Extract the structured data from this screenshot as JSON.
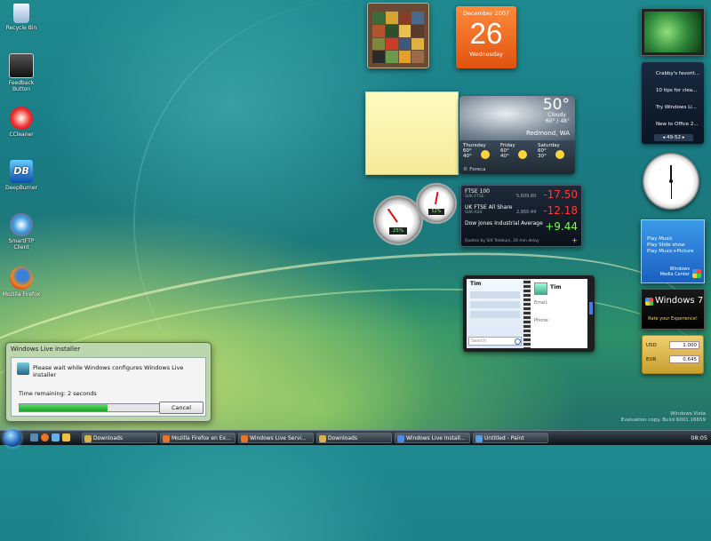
{
  "desktop_icons": [
    {
      "label": "Recycle Bin",
      "icon": "recycle-bin-icon"
    },
    {
      "label": "Feedback Button",
      "icon": "feedback-icon"
    },
    {
      "label": "CCleaner",
      "icon": "ccleaner-icon"
    },
    {
      "label": "DeepBurner",
      "icon": "deepburner-icon"
    },
    {
      "label": "SmartFTP Client",
      "icon": "ftp-icon"
    },
    {
      "label": "Mozilla Firefox",
      "icon": "firefox-icon"
    }
  ],
  "calendar": {
    "month_year": "December 2007",
    "day": "26",
    "weekday": "Wednesday"
  },
  "weather": {
    "temp": "50°",
    "condition": "Cloudy",
    "current_range": "60° / 48°",
    "location": "Redmond, WA",
    "forecast": [
      {
        "day": "Thursday",
        "hi": "60°",
        "lo": "40°"
      },
      {
        "day": "Friday",
        "hi": "60°",
        "lo": "40°"
      },
      {
        "day": "Saturday",
        "hi": "60°",
        "lo": "30°"
      }
    ],
    "source": "© Foreca"
  },
  "feeds": {
    "items": [
      "Crabby's favorit...",
      "10 tips for clea...",
      "Try Windows Li...",
      "New to Office 2..."
    ],
    "pager": "49-52"
  },
  "stocks": {
    "rows": [
      {
        "name": "FTSE 100",
        "sub": "SUK:FTSE",
        "value": "5,609.80",
        "change": "-17.50",
        "color": "#ff3030"
      },
      {
        "name": "UK FTSE All Share",
        "sub": "SUK:ASX",
        "value": "2,950.44",
        "change": "-12.18",
        "color": "#ff3030"
      },
      {
        "name": "Dow Jones Industrial Average",
        "sub": "",
        "value": "",
        "change": "+9.44",
        "color": "#7dff4a"
      }
    ],
    "footer": "Quotes by SIX Telekurs, 20 min delay"
  },
  "meters": {
    "cpu": "25%",
    "memory": "52%"
  },
  "contacts": {
    "search_placeholder": "Search",
    "list_header": "Tim",
    "name": "Tim",
    "email_label": "Email:",
    "phone_label": "Phone:"
  },
  "media_center": {
    "items": [
      "Play Music",
      "Play Slide show",
      "Play Music+Picture"
    ],
    "brand": "Windows Media Center"
  },
  "win7_ad": {
    "title": "Windows 7",
    "tagline": "Rate your Experience!"
  },
  "currency": {
    "rows": [
      {
        "code": "USD",
        "value": "1.000"
      },
      {
        "code": "EUR",
        "value": "0.645"
      }
    ]
  },
  "installer": {
    "title": "Windows Live installer",
    "message": "Please wait while Windows configures Windows Live installer",
    "time_remaining": "Time remaining: 2 seconds",
    "progress": 0.62,
    "cancel_label": "Cancel"
  },
  "taskbar": {
    "tasks": [
      {
        "label": "Downloads",
        "color": "#d8b24a"
      },
      {
        "label": "Mozilla Firefox en Ex...",
        "color": "#e8752a"
      },
      {
        "label": "Windows Live Servi...",
        "color": "#e8752a"
      },
      {
        "label": "Downloads",
        "color": "#d8b24a"
      },
      {
        "label": "Windows Live Install...",
        "color": "#4a8ae0"
      },
      {
        "label": "Untitled - Paint",
        "color": "#5aa0e0"
      }
    ],
    "clock": "08:05"
  },
  "watermark": {
    "line1": "Windows Vista",
    "line2": "Evaluation copy. Build 6001.16659"
  }
}
